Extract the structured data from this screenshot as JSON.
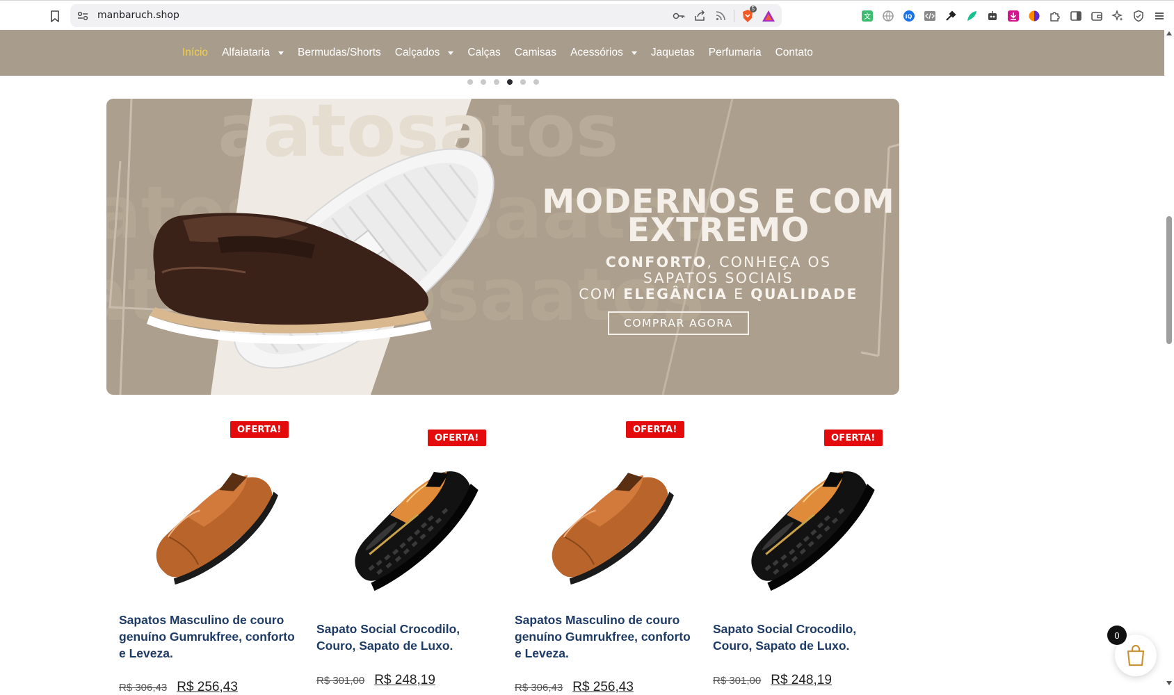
{
  "browser": {
    "url": "manbaruch.shop",
    "brave_shield_badge": "5"
  },
  "nav": {
    "items": [
      {
        "label": "Início",
        "active": true,
        "dropdown": false
      },
      {
        "label": "Alfaiataria",
        "active": false,
        "dropdown": true
      },
      {
        "label": "Bermudas/Shorts",
        "active": false,
        "dropdown": false
      },
      {
        "label": "Calçados",
        "active": false,
        "dropdown": true
      },
      {
        "label": "Calças",
        "active": false,
        "dropdown": false
      },
      {
        "label": "Camisas",
        "active": false,
        "dropdown": false
      },
      {
        "label": "Acessórios",
        "active": false,
        "dropdown": true
      },
      {
        "label": "Jaquetas",
        "active": false,
        "dropdown": false
      },
      {
        "label": "Perfumaria",
        "active": false,
        "dropdown": false
      },
      {
        "label": "Contato",
        "active": false,
        "dropdown": false
      }
    ],
    "active_color": "#f3d04c",
    "background": "#a89d8d"
  },
  "slider": {
    "dot_count": 6,
    "active_index": 3
  },
  "hero": {
    "title_line1": "MODERNOS E COM",
    "title_line2": "EXTREMO",
    "sub_bold1": "CONFORTO",
    "sub_text1": ", CONHEÇA OS",
    "sub_line2": "SAPATOS SOCIAIS",
    "sub_text3a": "COM ",
    "sub_bold2": "ELEGÂNCIA",
    "sub_text3b": " E ",
    "sub_bold3": "QUALIDADE",
    "cta_label": "COMPRAR AGORA",
    "watermark": "atosaatos"
  },
  "products": [
    {
      "badge": "OFERTA!",
      "title": "Sapatos Masculino de couro genuíno Gumrukfree, conforto e Leveza.",
      "old_price": "R$ 306,43",
      "new_price": "R$ 256,43",
      "shoe": "brown-loafer"
    },
    {
      "badge": "OFERTA!",
      "title": "Sapato Social Crocodilo, Couro, Sapato de Luxo.",
      "old_price": "R$ 301,00",
      "new_price": "R$ 248,19",
      "shoe": "black-croc"
    },
    {
      "badge": "OFERTA!",
      "title": "Sapatos Masculino de couro genuíno Gumrukfree, conforto e Leveza.",
      "old_price": "R$ 306,43",
      "new_price": "R$ 256,43",
      "shoe": "brown-loafer"
    },
    {
      "badge": "OFERTA!",
      "title": "Sapato Social Crocodilo, Couro, Sapato de Luxo.",
      "old_price": "R$ 301,00",
      "new_price": "R$ 248,19",
      "shoe": "black-croc"
    }
  ],
  "cart": {
    "count": "0"
  },
  "colors": {
    "badge_red": "#e30b0b",
    "title_blue": "#1e3b66",
    "hero_bg": "#ad9f8d"
  }
}
